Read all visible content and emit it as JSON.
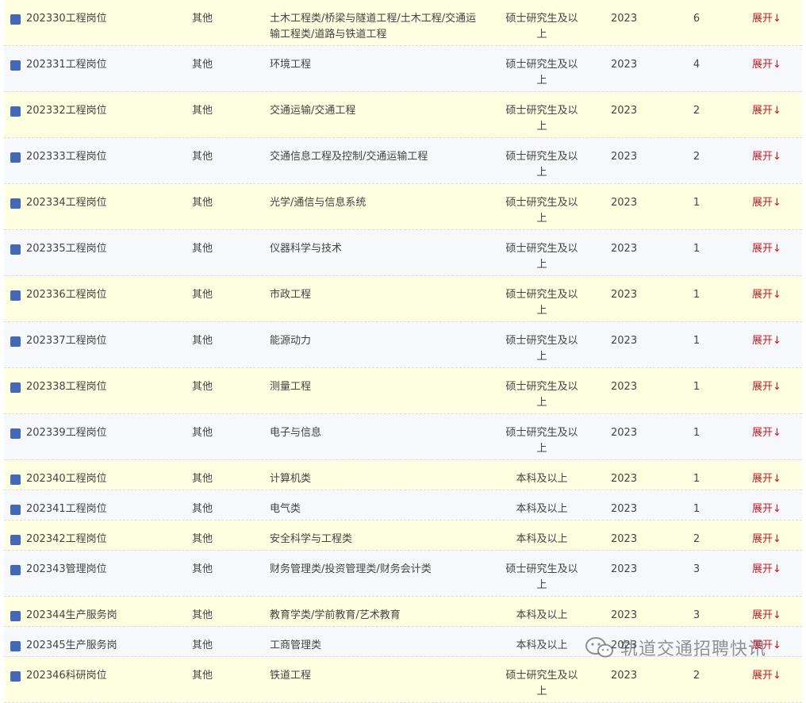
{
  "rows": [
    {
      "name": "202330工程岗位",
      "type": "其他",
      "major": "土木工程类/桥梁与隧道工程/土木工程/交通运输工程类/道路与铁道工程",
      "education": "硕士研究生及以上",
      "year": "2023",
      "count": "6",
      "action": "展开↓"
    },
    {
      "name": "202331工程岗位",
      "type": "其他",
      "major": "环境工程",
      "education": "硕士研究生及以上",
      "year": "2023",
      "count": "4",
      "action": "展开↓"
    },
    {
      "name": "202332工程岗位",
      "type": "其他",
      "major": "交通运输/交通工程",
      "education": "硕士研究生及以上",
      "year": "2023",
      "count": "2",
      "action": "展开↓"
    },
    {
      "name": "202333工程岗位",
      "type": "其他",
      "major": "交通信息工程及控制/交通运输工程",
      "education": "硕士研究生及以上",
      "year": "2023",
      "count": "2",
      "action": "展开↓"
    },
    {
      "name": "202334工程岗位",
      "type": "其他",
      "major": "光学/通信与信息系统",
      "education": "硕士研究生及以上",
      "year": "2023",
      "count": "1",
      "action": "展开↓"
    },
    {
      "name": "202335工程岗位",
      "type": "其他",
      "major": "仪器科学与技术",
      "education": "硕士研究生及以上",
      "year": "2023",
      "count": "1",
      "action": "展开↓"
    },
    {
      "name": "202336工程岗位",
      "type": "其他",
      "major": "市政工程",
      "education": "硕士研究生及以上",
      "year": "2023",
      "count": "1",
      "action": "展开↓"
    },
    {
      "name": "202337工程岗位",
      "type": "其他",
      "major": "能源动力",
      "education": "硕士研究生及以上",
      "year": "2023",
      "count": "1",
      "action": "展开↓"
    },
    {
      "name": "202338工程岗位",
      "type": "其他",
      "major": "测量工程",
      "education": "硕士研究生及以上",
      "year": "2023",
      "count": "1",
      "action": "展开↓"
    },
    {
      "name": "202339工程岗位",
      "type": "其他",
      "major": "电子与信息",
      "education": "硕士研究生及以上",
      "year": "2023",
      "count": "1",
      "action": "展开↓"
    },
    {
      "name": "202340工程岗位",
      "type": "其他",
      "major": "计算机类",
      "education": "本科及以上",
      "year": "2023",
      "count": "1",
      "action": "展开↓"
    },
    {
      "name": "202341工程岗位",
      "type": "其他",
      "major": "电气类",
      "education": "本科及以上",
      "year": "2023",
      "count": "1",
      "action": "展开↓"
    },
    {
      "name": "202342工程岗位",
      "type": "其他",
      "major": "安全科学与工程类",
      "education": "本科及以上",
      "year": "2023",
      "count": "2",
      "action": "展开↓"
    },
    {
      "name": "202343管理岗位",
      "type": "其他",
      "major": "财务管理类/投资管理类/财务会计类",
      "education": "硕士研究生及以上",
      "year": "2023",
      "count": "3",
      "action": "展开↓"
    },
    {
      "name": "202344生产服务岗",
      "type": "其他",
      "major": "教育学类/学前教育/艺术教育",
      "education": "本科及以上",
      "year": "2023",
      "count": "3",
      "action": "展开↓"
    },
    {
      "name": "202345生产服务岗",
      "type": "其他",
      "major": "工商管理类",
      "education": "本科及以上",
      "year": "2023",
      "count": "",
      "action": "展开↓"
    },
    {
      "name": "202346科研岗位",
      "type": "其他",
      "major": "铁道工程",
      "education": "硕士研究生及以上",
      "year": "2023",
      "count": "2",
      "action": "展开↓"
    }
  ],
  "watermark": {
    "text": "轨道交通招聘快讯",
    "icon": "wechat-icon"
  },
  "colors": {
    "row_odd": "#fefee0",
    "row_even": "#f7f8fc",
    "marker": "#4468b8",
    "expand": "#d0161c"
  }
}
